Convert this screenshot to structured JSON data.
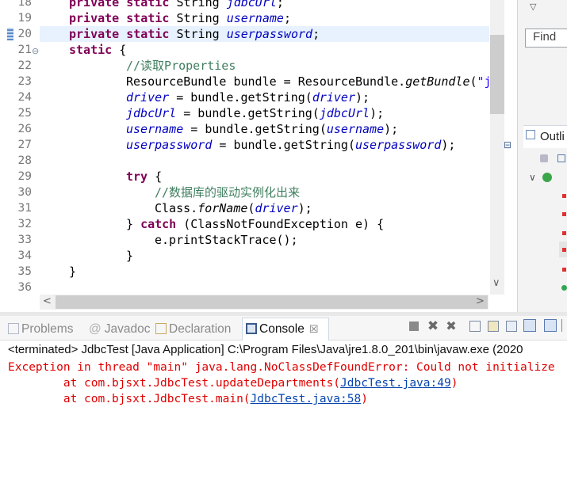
{
  "editor": {
    "lines": [
      {
        "n": "18"
      },
      {
        "n": "19"
      },
      {
        "n": "20"
      },
      {
        "n": "21"
      },
      {
        "n": "22"
      },
      {
        "n": "23"
      },
      {
        "n": "24"
      },
      {
        "n": "25"
      },
      {
        "n": "26"
      },
      {
        "n": "27"
      },
      {
        "n": "28"
      },
      {
        "n": "29"
      },
      {
        "n": "30"
      },
      {
        "n": "31"
      },
      {
        "n": "32"
      },
      {
        "n": "33"
      },
      {
        "n": "34"
      },
      {
        "n": "35"
      },
      {
        "n": "36"
      }
    ],
    "code": {
      "l18_kw": "private static",
      "l18_type": " String ",
      "l18_field": "jdbcUrl",
      "l18_end": ";",
      "l19_kw": "private static",
      "l19_type": " String ",
      "l19_field": "username",
      "l19_end": ";",
      "l20_kw": "private static",
      "l20_type": " String ",
      "l20_field": "userpassword",
      "l20_end": ";",
      "l21_kw": "static",
      "l21_end": " {",
      "l22_comment": "//读取Properties",
      "l23_a": "ResourceBundle bundle = ResourceBundle.",
      "l23_static": "getBundle",
      "l23_b": "(",
      "l23_str": "\"j",
      "l24_field": "driver",
      "l24_a": " = bundle.getString(",
      "l24_arg": "driver",
      "l24_end": ");",
      "l25_field": "jdbcUrl",
      "l25_a": " = bundle.getString(",
      "l25_arg": "jdbcUrl",
      "l25_end": ");",
      "l26_field": "username",
      "l26_a": " = bundle.getString(",
      "l26_arg": "username",
      "l26_end": ");",
      "l27_field": "userpassword",
      "l27_a": " = bundle.getString(",
      "l27_arg": "userpassword",
      "l27_end": ");",
      "l29_kw": "try",
      "l29_end": " {",
      "l30_comment": "//数据库的驱动实例化出来",
      "l31_a": "Class.",
      "l31_static": "forName",
      "l31_b": "(",
      "l31_arg": "driver",
      "l31_end": ");",
      "l32_a": "} ",
      "l32_kw": "catch",
      "l32_b": " (ClassNotFoundException e) {",
      "l33": "e.printStackTrace();",
      "l34": "}",
      "l35": "}"
    }
  },
  "right_panel": {
    "find_placeholder": "Find",
    "outline_label": "Outli"
  },
  "console_tabs": [
    {
      "label": "Problems"
    },
    {
      "label": "Javadoc"
    },
    {
      "label": "Declaration"
    },
    {
      "label": "Console"
    }
  ],
  "console_close": "☒",
  "console": {
    "header": "<terminated> JdbcTest [Java Application] C:\\Program Files\\Java\\jre1.8.0_201\\bin\\javaw.exe (2020",
    "error_line": "Exception in thread \"main\" java.lang.NoClassDefFoundError: Could not initialize",
    "trace1_prefix": "        at com.bjsxt.JdbcTest.updateDepartments(",
    "trace1_link": "JdbcTest.java:49",
    "trace1_suffix": ")",
    "trace2_prefix": "        at com.bjsxt.JdbcTest.main(",
    "trace2_link": "JdbcTest.java:58",
    "trace2_suffix": ")"
  },
  "colors": {
    "keyword": "#7f0055",
    "field": "#0000c0",
    "comment": "#3f7f5f",
    "error": "#e00000",
    "link": "#0645ad"
  }
}
